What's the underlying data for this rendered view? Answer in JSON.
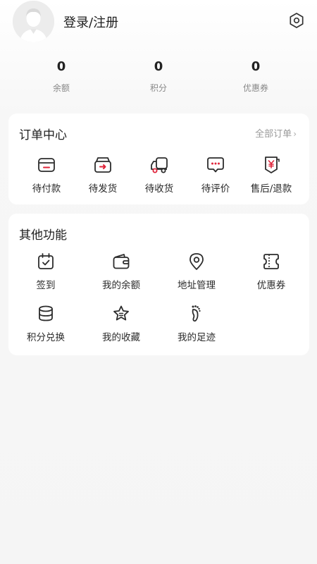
{
  "header": {
    "login_label": "登录/注册"
  },
  "stats": [
    {
      "value": "0",
      "label": "余额"
    },
    {
      "value": "0",
      "label": "积分"
    },
    {
      "value": "0",
      "label": "优惠券"
    }
  ],
  "orders": {
    "title": "订单中心",
    "all_label": "全部订单",
    "items": [
      {
        "label": "待付款",
        "icon": "wallet-card-icon"
      },
      {
        "label": "待发货",
        "icon": "box-arrow-icon"
      },
      {
        "label": "待收货",
        "icon": "truck-icon"
      },
      {
        "label": "待评价",
        "icon": "chat-bubble-icon"
      },
      {
        "label": "售后/退款",
        "icon": "yen-refund-icon"
      }
    ]
  },
  "other": {
    "title": "其他功能",
    "items": [
      {
        "label": "签到",
        "icon": "calendar-check-icon"
      },
      {
        "label": "我的余额",
        "icon": "wallet-icon"
      },
      {
        "label": "地址管理",
        "icon": "location-pin-icon"
      },
      {
        "label": "优惠券",
        "icon": "coupon-icon"
      },
      {
        "label": "积分兑换",
        "icon": "coin-stack-icon"
      },
      {
        "label": "我的收藏",
        "icon": "star-icon"
      },
      {
        "label": "我的足迹",
        "icon": "footprint-icon"
      }
    ]
  },
  "colors": {
    "accent": "#e0243a",
    "card": "#ffffff",
    "background": "#f5f5f5"
  }
}
